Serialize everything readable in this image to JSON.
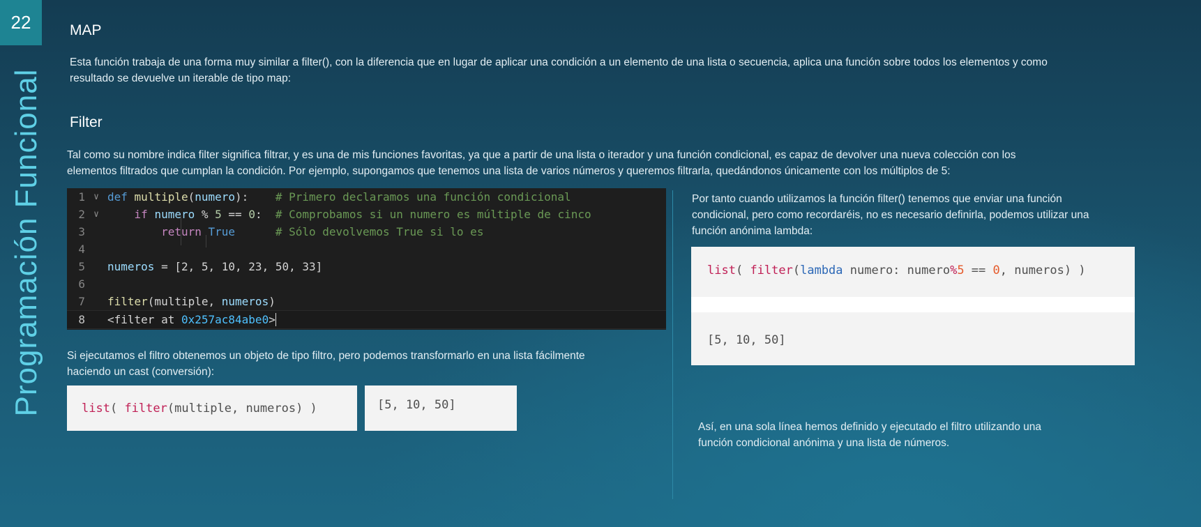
{
  "slide_number": "22",
  "side_title": "Programación Funcional",
  "map_section": {
    "heading": "MAP",
    "text_line1": "Esta función trabaja de una forma muy similar a filter(), con la diferencia que en lugar de aplicar una condición a un elemento de una lista o secuencia, aplica una función sobre todos los elementos y como",
    "text_line2": "resultado se devuelve un iterable de tipo map:"
  },
  "filter_section": {
    "heading": "Filter",
    "intro_line1": "Tal como su nombre indica filter significa filtrar, y es una de mis funciones favoritas, ya que a partir de una lista o iterador y una función condicional, es capaz de devolver una nueva colección con los",
    "intro_line2": "elementos filtrados que cumplan la condición. Por ejemplo, supongamos que tenemos una lista de varios números y queremos filtrarla, quedándonos únicamente con los múltiplos de 5:"
  },
  "code_editor": {
    "line_numbers": [
      "1",
      "2",
      "3",
      "4",
      "5",
      "6",
      "7",
      "8"
    ],
    "lines": {
      "l1_def": "def",
      "l1_fn": "multiple",
      "l1_open": "(",
      "l1_param": "numero",
      "l1_close": "):    ",
      "l1_comment": "# Primero declaramos una función condicional",
      "l2_if": "if",
      "l2_var": "numero",
      "l2_op": " % ",
      "l2_num1": "5",
      "l2_eq": " == ",
      "l2_num2": "0",
      "l2_colon": ":  ",
      "l2_comment": "# Comprobamos si un numero es múltiple de cinco",
      "l3_return": "return",
      "l3_true": "True",
      "l3_pad": "      ",
      "l3_comment": "# Sólo devolvemos True si lo es",
      "l5_var": "numeros",
      "l5_rest": " = [2, 5, 10, 23, 50, 33]",
      "l7_fn": "filter",
      "l7_open": "(multiple, ",
      "l7_var": "numeros",
      "l7_close": ")",
      "l8_a": "<filter at ",
      "l8_hex": "0x257ac84abe0",
      "l8_b": ">"
    }
  },
  "cast_section": {
    "text_line1": "Si ejecutamos el filtro obtenemos un objeto de tipo filtro, pero podemos transformarlo en una lista fácilmente",
    "text_line2": "haciendo un cast (conversión):",
    "code_list": "list",
    "code_open": "( ",
    "code_filter": "filter",
    "code_args": "(multiple, numeros) )",
    "result": "[5, 10, 50]"
  },
  "lambda_section": {
    "text_line1": "Por tanto cuando utilizamos la función filter() tenemos que enviar una función",
    "text_line2": "condicional, pero como recordaréis, no es necesario definirla, podemos utilizar una",
    "text_line3": "función anónima lambda:",
    "code_list": "list",
    "code_open": "( ",
    "code_filter": "filter",
    "code_paren": "(",
    "code_lambda": "lambda",
    "code_mid": " numero: numero",
    "code_pct": "%",
    "code_5": "5",
    "code_eq": " == ",
    "code_0": "0",
    "code_end": ", numeros) )",
    "result": "[5, 10, 50]"
  },
  "conclusion": {
    "text_line1": "Así, en una sola línea hemos definido y ejecutado el filtro utilizando una",
    "text_line2": "función condicional anónima y una lista de números."
  },
  "colors": {
    "accent": "#5fd0e6",
    "slide_number_bg": "#1e8493",
    "background": "#1a5670"
  }
}
